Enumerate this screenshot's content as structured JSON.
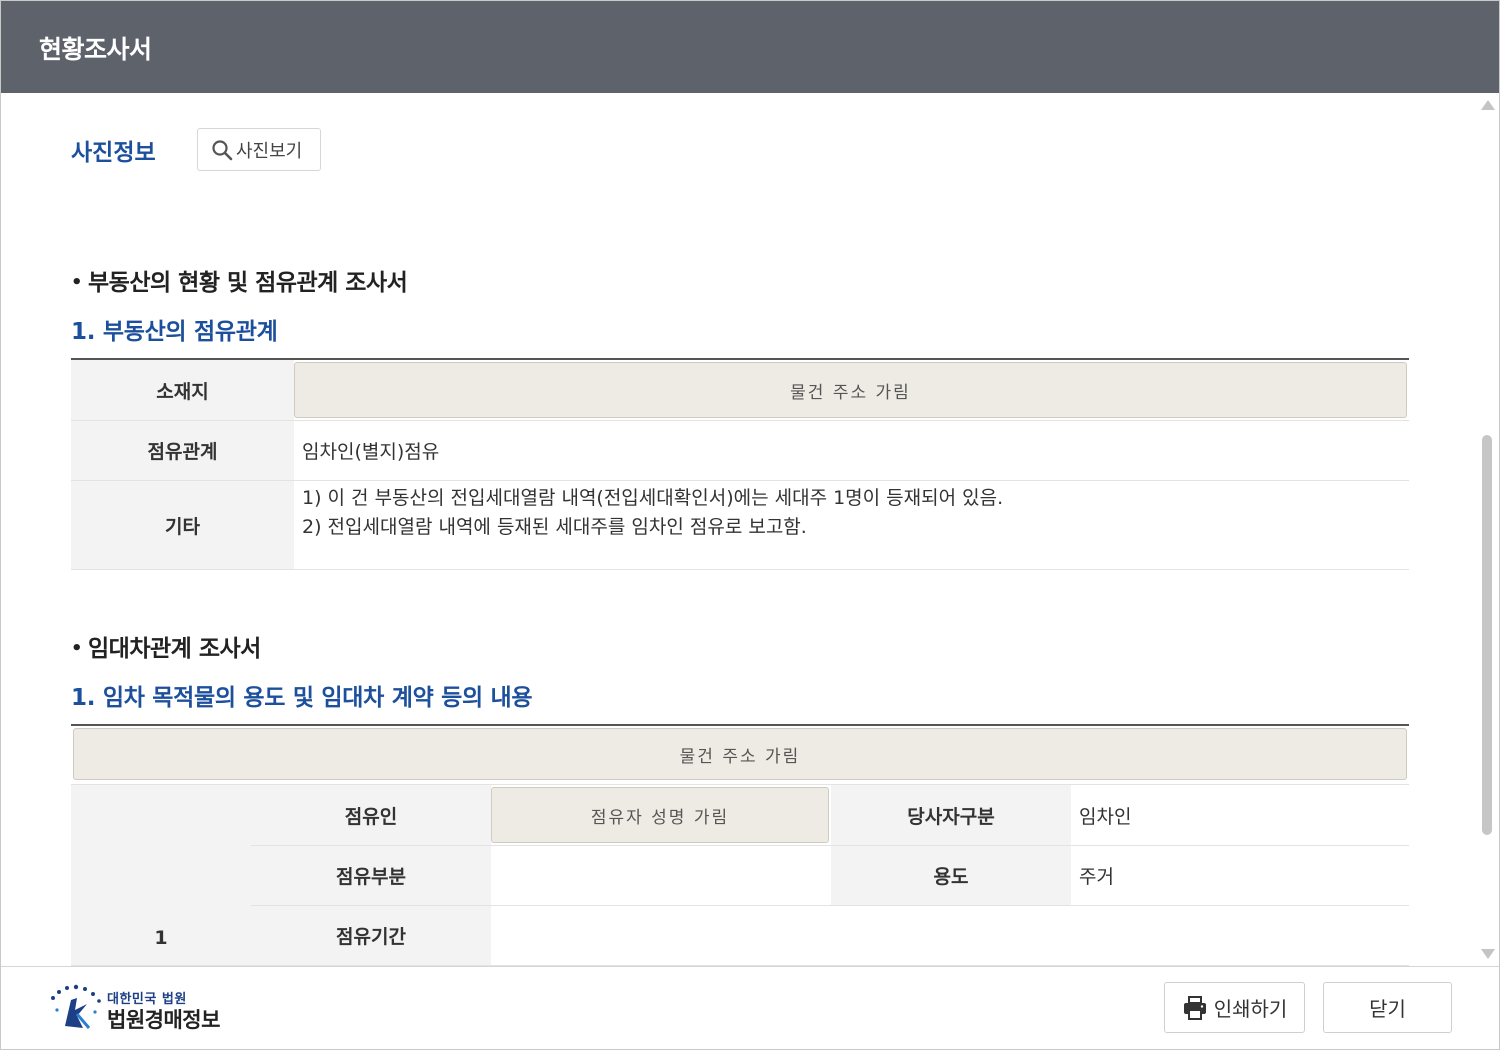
{
  "window": {
    "title": "현황조사서"
  },
  "photo": {
    "label": "사진정보",
    "button_label": "사진보기"
  },
  "section1": {
    "heading": "부동산의 현황 및 점유관계 조사서",
    "subheading": "1. 부동산의 점유관계",
    "rows": {
      "location_label": "소재지",
      "location_value": "물건 주소 가림",
      "occupancy_label": "점유관계",
      "occupancy_value": "임차인(별지)점유",
      "etc_label": "기타",
      "etc_lines": [
        "1) 이 건 부동산의 전입세대열람 내역(전입세대확인서)에는 세대주 1명이 등재되어 있음.",
        "2) 전입세대열람 내역에 등재된 세대주를 임차인 점유로 보고함."
      ]
    }
  },
  "section2": {
    "heading": "임대차관계 조사서",
    "subheading": "1. 임차 목적물의 용도 및 임대차 계약 등의 내용",
    "address_masked": "물건 주소 가림",
    "entry": {
      "number": "1",
      "occupant_label": "점유인",
      "occupant_value": "점유자 성명 가림",
      "party_type_label": "당사자구분",
      "party_type_value": "임차인",
      "occupied_part_label": "점유부분",
      "occupied_part_value": "",
      "purpose_label": "용도",
      "purpose_value": "주거",
      "period_label": "점유기간",
      "period_value": ""
    }
  },
  "footer": {
    "logo_small": "대한민국 법원",
    "logo_big": "법원경매정보",
    "print_label": "인쇄하기",
    "close_label": "닫기"
  },
  "colors": {
    "header_bg": "#5e626a",
    "accent_blue": "#1c4f9c",
    "mask_bg": "#eeebe4"
  }
}
